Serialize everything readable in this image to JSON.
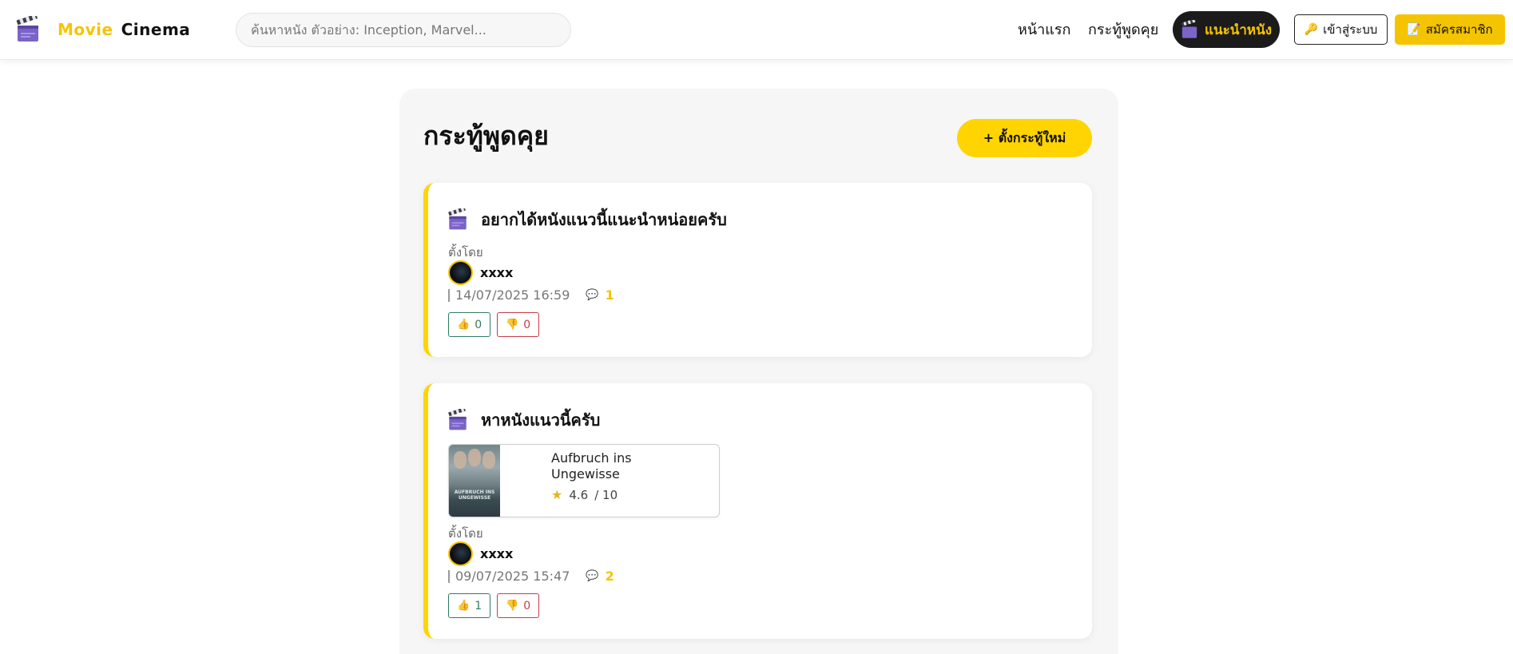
{
  "header": {
    "brand_part1": "Movie",
    "brand_part2": "Cinema",
    "search_placeholder": "ค้นหาหนัง ตัวอย่าง: Inception, Marvel...",
    "nav_home": "หน้าแรก",
    "nav_board": "กระทู้พูดคุย",
    "nav_recommend": "แนะนำหนัง",
    "login_label": "เข้าสู่ระบบ",
    "register_label": "สมัครสมาชิก"
  },
  "board": {
    "title": "กระทู้พูดคุย",
    "new_topic_label": "+ ตั้งกระทู้ใหม่",
    "posts": [
      {
        "title": "อยากได้หนังแนวนี้แนะนำหน่อยครับ",
        "by_label": "ตั้งโดย",
        "author": "xxxx",
        "datetime": "14/07/2025 16:59",
        "comments": "1",
        "likes": "0",
        "dislikes": "0"
      },
      {
        "title": "หาหนังแนวนี้ครับ",
        "movie": {
          "name": "Aufbruch ins Ungewisse",
          "poster_text": "AUFBRUCH INS UNGEWISSE",
          "rating": "4.6",
          "rating_max": "/ 10"
        },
        "by_label": "ตั้งโดย",
        "author": "xxxx",
        "datetime": "09/07/2025 15:47",
        "comments": "2",
        "likes": "1",
        "dislikes": "0"
      }
    ]
  },
  "colors": {
    "accent_yellow": "#ffd400",
    "dark": "#1b1b1b",
    "like_green": "#2f7d5f",
    "dislike_red": "#c73c49"
  },
  "icons": {
    "logo": "clapperboard-icon",
    "post": "clapperboard-icon",
    "login": "key-icon",
    "register": "memo-icon",
    "comment": "speech-bubble-icon",
    "like": "thumbs-up-icon",
    "dislike": "thumbs-down-icon",
    "rating": "star-icon"
  }
}
